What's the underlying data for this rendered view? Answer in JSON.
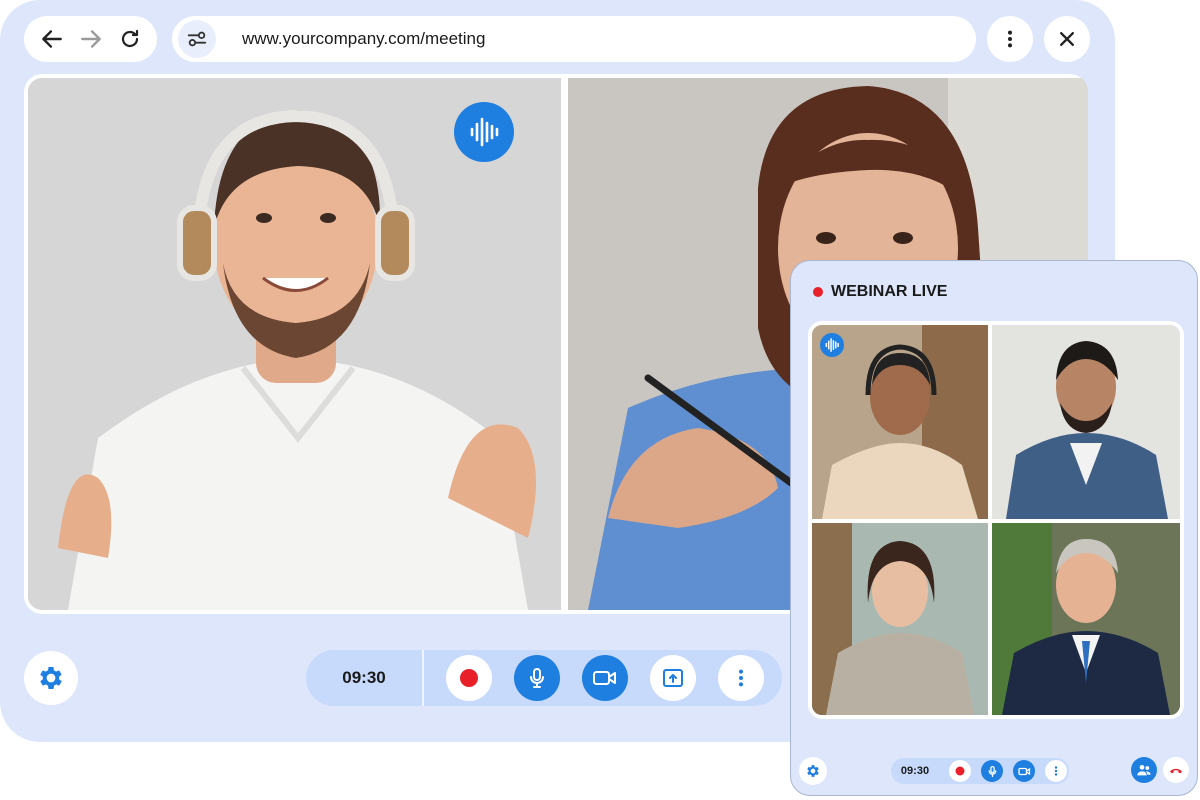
{
  "browser": {
    "url": "www.yourcompany.com/meeting",
    "icons": {
      "back": "arrow-left-icon",
      "forward": "arrow-right-icon",
      "reload": "refresh-icon",
      "site_settings": "sliders-icon",
      "menu": "more-vertical-icon",
      "close": "close-icon"
    }
  },
  "meeting": {
    "timer": "09:30",
    "colors": {
      "accent": "#1f7fe0",
      "record": "#e8202a",
      "window_bg": "#dde6fb",
      "control_bar": "#c7dafc"
    }
  },
  "webinar": {
    "title": "WEBINAR LIVE",
    "timer": "09:30"
  }
}
